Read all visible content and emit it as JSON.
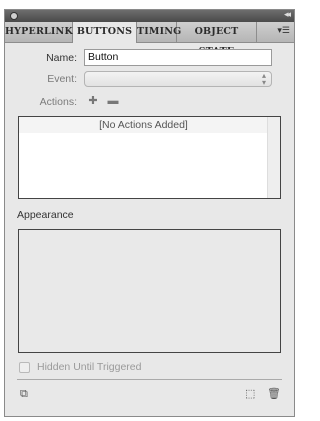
{
  "window": {
    "tabs": [
      "HYPERLINKS",
      "BUTTONS",
      "TIMING",
      "OBJECT STATE"
    ],
    "active_tab": "BUTTONS",
    "panel_menu_icon": "panel-menu-icon"
  },
  "form": {
    "name_label": "Name:",
    "name_value": "Button",
    "event_label": "Event:",
    "event_value": "",
    "actions_label": "Actions:",
    "actions_empty": "[No Actions Added]"
  },
  "appearance": {
    "title": "Appearance"
  },
  "options": {
    "hidden_until_triggered": "Hidden Until Triggered",
    "hidden_checked": false
  },
  "footer": {
    "icons": [
      "preview-icon",
      "convert-object-icon",
      "delete-icon"
    ]
  }
}
